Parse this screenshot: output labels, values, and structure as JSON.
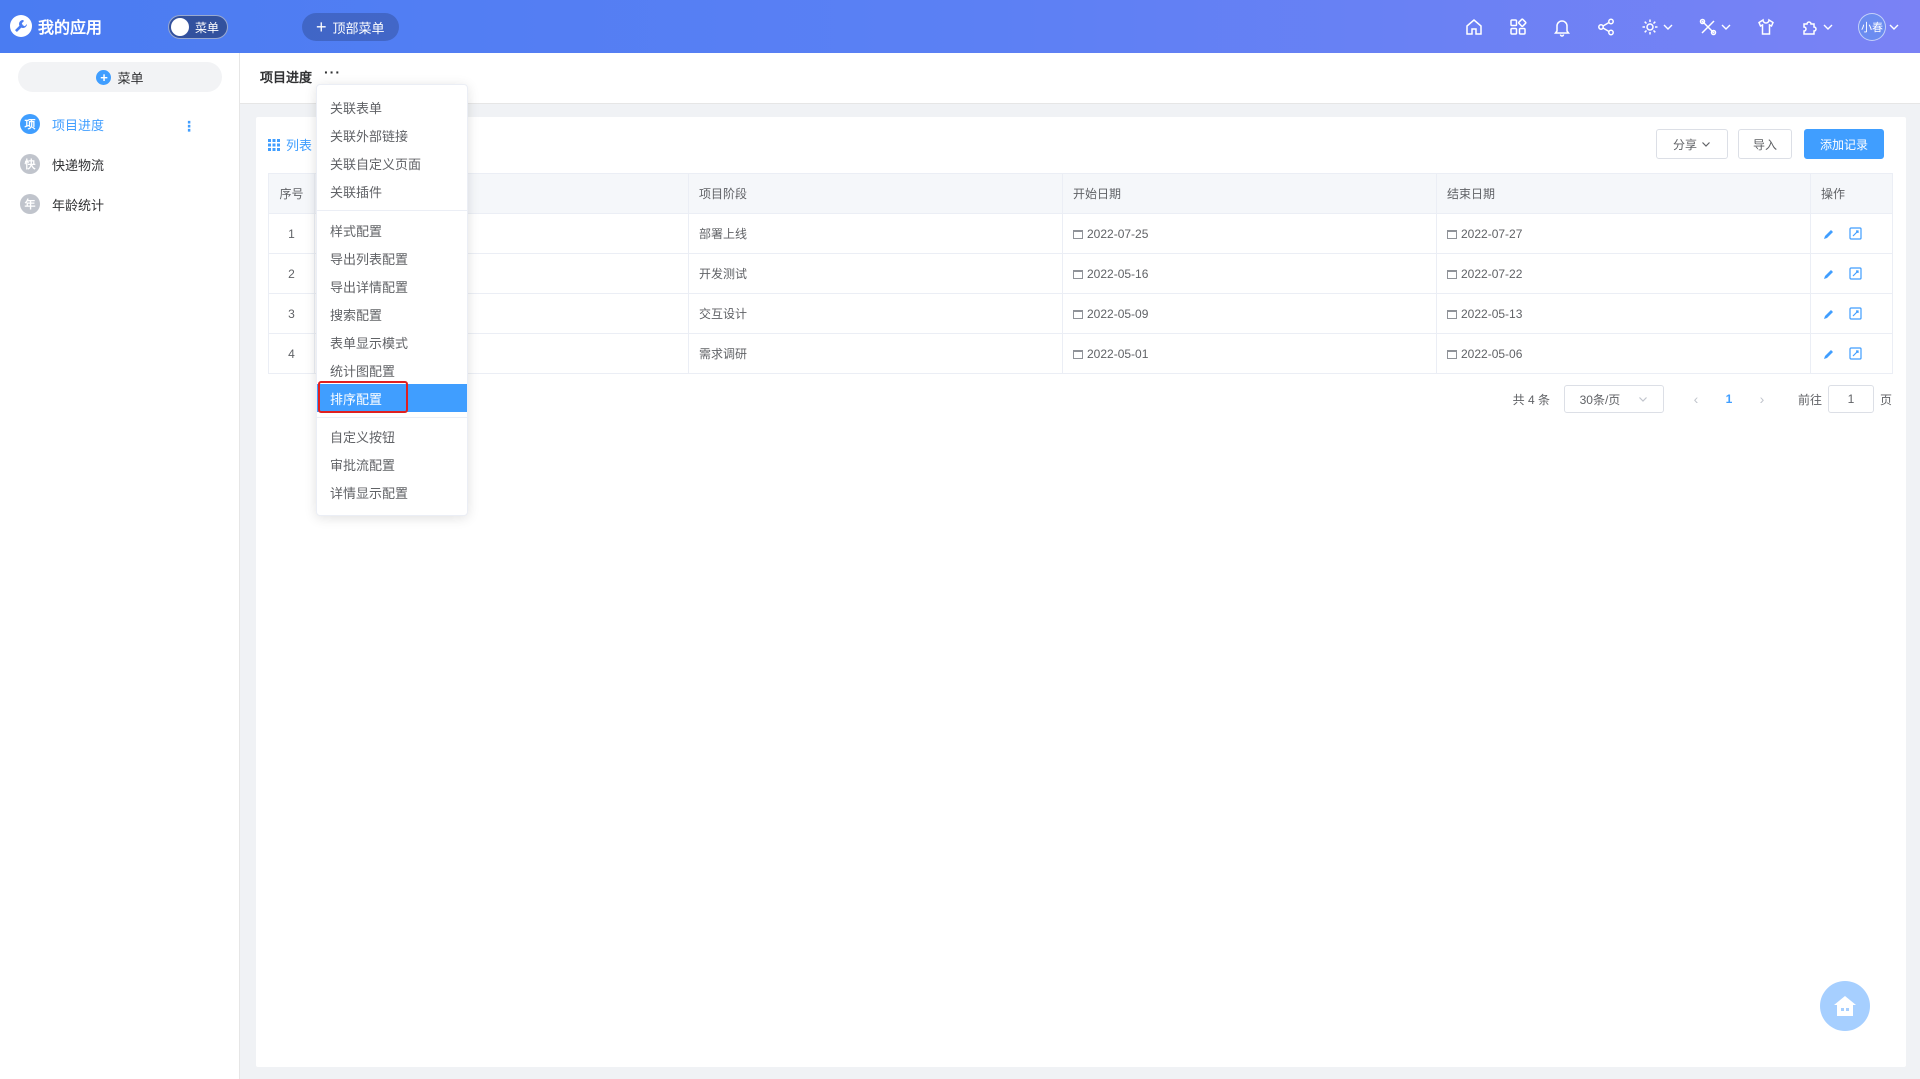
{
  "app": {
    "title": "我的应用",
    "menu_toggle_label": "菜单",
    "top_menu_button": "顶部菜单"
  },
  "header": {
    "icons": [
      "home-icon",
      "apps-icon",
      "bell-icon",
      "share-icon",
      "gear-icon",
      "tools-icon",
      "shirt-icon",
      "plugin-icon"
    ],
    "user_name": "小春"
  },
  "sidebar": {
    "add_button": "菜单",
    "items": [
      {
        "badge": "项",
        "label": "项目进度",
        "active": true
      },
      {
        "badge": "快",
        "label": "快递物流",
        "active": false
      },
      {
        "badge": "年",
        "label": "年龄统计",
        "active": false
      }
    ]
  },
  "breadcrumb": {
    "title": "项目进度",
    "more": "···"
  },
  "toolbar": {
    "view_tab": "列表",
    "share": "分享",
    "import": "导入",
    "add_record": "添加记录"
  },
  "table": {
    "headers": [
      "序号",
      "",
      "项目阶段",
      "开始日期",
      "结束日期",
      "操作"
    ],
    "rows": [
      {
        "no": "1",
        "stage": "部署上线",
        "start": "2022-07-25",
        "end": "2022-07-27"
      },
      {
        "no": "2",
        "stage": "开发测试",
        "start": "2022-05-16",
        "end": "2022-07-22"
      },
      {
        "no": "3",
        "stage": "交互设计",
        "start": "2022-05-09",
        "end": "2022-05-13"
      },
      {
        "no": "4",
        "stage": "需求调研",
        "start": "2022-05-01",
        "end": "2022-05-06"
      }
    ]
  },
  "pager": {
    "total": "共 4 条",
    "page_size": "30条/页",
    "current": "1",
    "goto_label": "前往",
    "goto_value": "1",
    "page_suffix": "页"
  },
  "dropdown": {
    "groups": [
      [
        "关联表单",
        "关联外部链接",
        "关联自定义页面",
        "关联插件"
      ],
      [
        "样式配置",
        "导出列表配置",
        "导出详情配置",
        "搜索配置",
        "表单显示模式",
        "统计图配置",
        "排序配置"
      ],
      [
        "自定义按钮",
        "审批流配置",
        "详情显示配置"
      ]
    ],
    "active_item": "排序配置"
  },
  "colors": {
    "accent": "#409eff",
    "highlight": "#e02020",
    "header_start": "#4a7cf2",
    "header_end": "#7a82f5"
  }
}
